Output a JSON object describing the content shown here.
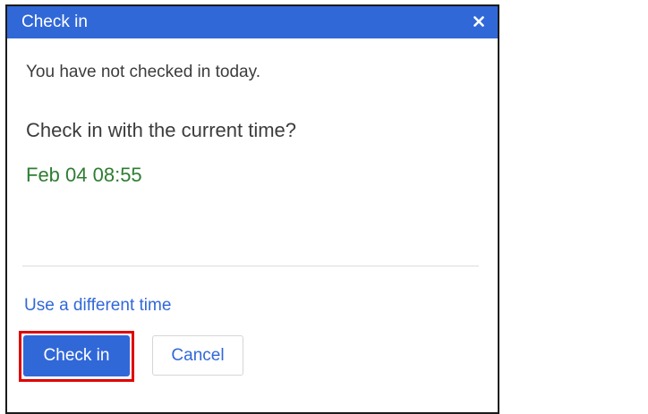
{
  "dialog": {
    "title": "Check in",
    "close_icon": "close-icon",
    "message": "You have not checked in today.",
    "question": "Check in with the current time?",
    "current_time": "Feb 04 08:55",
    "different_time_link": "Use a different time",
    "checkin_label": "Check in",
    "cancel_label": "Cancel"
  },
  "colors": {
    "header_bg": "#3168d8",
    "time_text": "#2e7d32",
    "link": "#3168d8",
    "highlight": "#e00000"
  }
}
